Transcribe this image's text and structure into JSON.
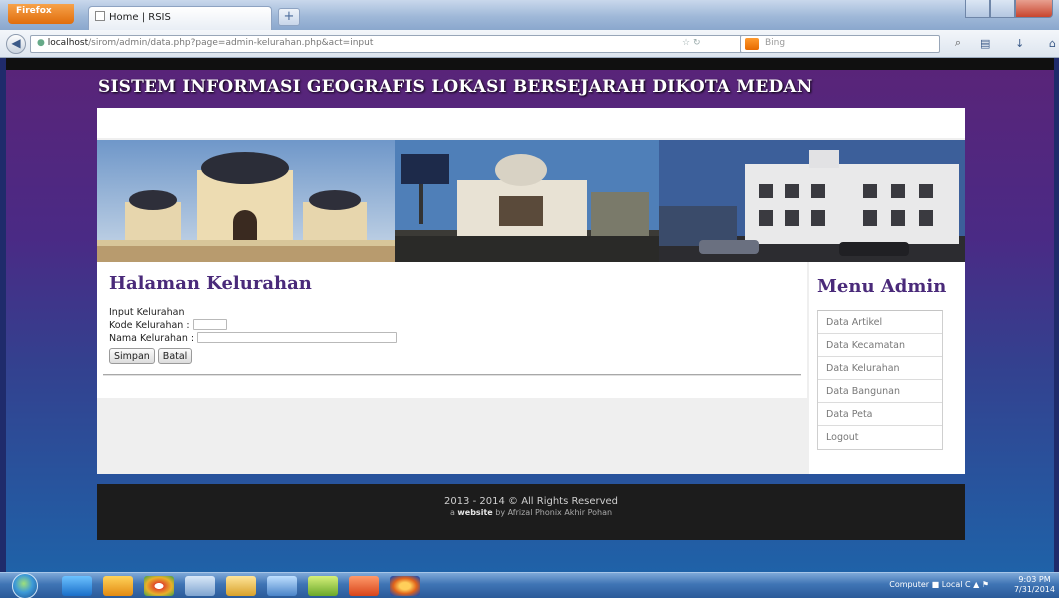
{
  "browser": {
    "menu_button": "Firefox",
    "tab_title": "Home | RSIS",
    "new_tab": "+",
    "url_host": "localhost",
    "url_path": "/sirom/admin/data.php?page=admin-kelurahan.php&act=input",
    "search_placeholder": "Bing",
    "icons": [
      "back-arrow-icon",
      "star-icon",
      "reload-icon",
      "search-icon",
      "bookmarks-icon",
      "download-icon",
      "home-icon"
    ]
  },
  "site": {
    "title": "SISTEM INFORMASI GEOGRAFIS LOKASI BERSEJARAH DIKOTA MEDAN"
  },
  "main": {
    "page_title": "Halaman Kelurahan",
    "form": {
      "input_label": "Input Kelurahan",
      "kode_label": "Kode Kelurahan :",
      "kode_value": "",
      "nama_label": "Nama Kelurahan :",
      "nama_value": "",
      "save_button": "Simpan",
      "cancel_button": "Batal"
    }
  },
  "sidebar": {
    "title": "Menu Admin",
    "items": [
      {
        "label": "Data Artikel"
      },
      {
        "label": "Data Kecamatan"
      },
      {
        "label": "Data Kelurahan"
      },
      {
        "label": "Data Bangunan"
      },
      {
        "label": "Data Peta"
      },
      {
        "label": "Logout"
      }
    ]
  },
  "footer": {
    "line1": "2013 - 2014 © All Rights Reserved",
    "line2_prefix": "a",
    "line2_bold": "website",
    "line2_suffix": "by Afrizal Phonix Akhir Pohan"
  },
  "taskbar": {
    "tray_text": "Computer",
    "drive_text": "Local C",
    "time": "9:03 PM",
    "date": "7/31/2014"
  },
  "colors": {
    "heading": "#4a2a7a",
    "background_top": "#5a2478",
    "background_bottom": "#1f62a8",
    "footer": "#1c1c1c"
  }
}
